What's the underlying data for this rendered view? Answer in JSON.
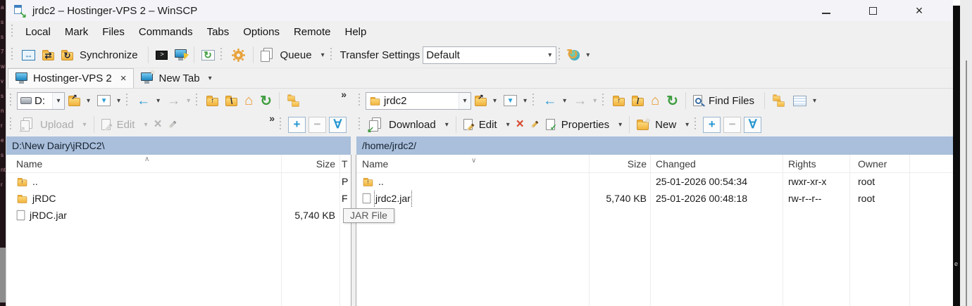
{
  "window": {
    "title": "jrdc2 – Hostinger-VPS 2 – WinSCP"
  },
  "icons": {
    "minimize": "–",
    "maximize": "□",
    "close": "×",
    "dropdown": "▾",
    "overflow": "»",
    "back": "←",
    "forward": "→",
    "refresh": "↻",
    "home": "⌂",
    "swap": "↔",
    "terminal": ">",
    "check": "✓",
    "star": "★",
    "down_left": "↙",
    "up_right": "↗",
    "sync": "⇄",
    "up": "↑",
    "backslash": "\\",
    "slash": "/",
    "plus": "+",
    "minus": "−",
    "invert": "∀",
    "sort_asc": "∧",
    "sort_desc": "∨",
    "funnel": "▼",
    "win_arrow": "↘"
  },
  "menu": {
    "items": [
      "Local",
      "Mark",
      "Files",
      "Commands",
      "Tabs",
      "Options",
      "Remote",
      "Help"
    ]
  },
  "toolbar": {
    "synchronize": "Synchronize",
    "queue": "Queue",
    "transfer_settings": "Transfer Settings",
    "transfer_value": "Default"
  },
  "tabs": {
    "active": "Hostinger-VPS 2",
    "new_tab": "New Tab"
  },
  "local": {
    "drive": "D:",
    "path": "D:\\New Dairy\\jRDC2\\",
    "upload": "Upload",
    "edit": "Edit",
    "columns": {
      "name": "Name",
      "size": "Size",
      "type": "T"
    },
    "rows": [
      {
        "name": "..",
        "type": "P"
      },
      {
        "name": "jRDC",
        "type": "F"
      },
      {
        "name": "jRDC.jar",
        "size": "5,740 KB"
      }
    ]
  },
  "remote": {
    "dir": "jrdc2",
    "path": "/home/jrdc2/",
    "find_files": "Find Files",
    "download": "Download",
    "edit": "Edit",
    "properties": "Properties",
    "new": "New",
    "columns": {
      "name": "Name",
      "size": "Size",
      "changed": "Changed",
      "rights": "Rights",
      "owner": "Owner"
    },
    "rows": [
      {
        "name": "..",
        "changed": "25-01-2026 00:54:34",
        "rights": "rwxr-xr-x",
        "owner": "root"
      },
      {
        "name": "jrdc2.jar",
        "size": "5,740 KB",
        "changed": "25-01-2026 00:48:18",
        "rights": "rw-r--r--",
        "owner": "root"
      }
    ]
  },
  "tooltip": "JAR File",
  "background": {
    "left_fragments": "a\ns\ns\n7\nw\nv\ns\nn\nr\ne\ns\nnt\nr",
    "right_fragment": "e"
  },
  "colors": {
    "accent_blue": "#2596d1",
    "folder_yellow": "#f1b33c",
    "delete_red": "#d7482f",
    "sync_green": "#3f9d3f",
    "path_header_bg": "#a9bfdb"
  }
}
